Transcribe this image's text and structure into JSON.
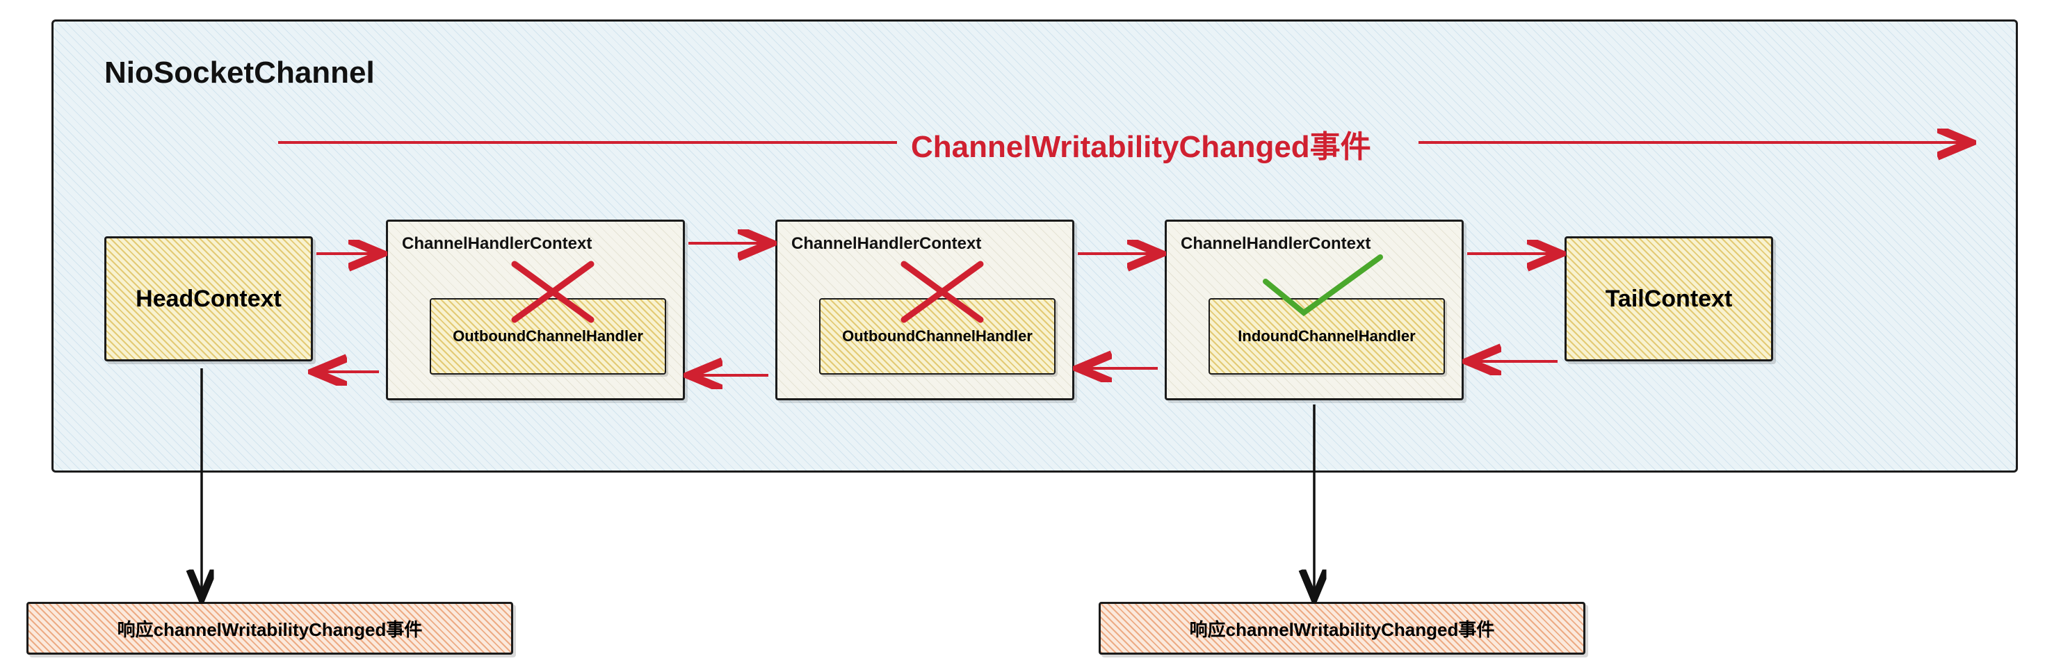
{
  "container_title": "NioSocketChannel",
  "event_label": "ChannelWritabilityChanged事件",
  "head_context": "HeadContext",
  "tail_context": "TailContext",
  "ctx_label": "ChannelHandlerContext",
  "outbound_handler": "OutboundChannelHandler",
  "inbound_handler": "IndoundChannelHandler",
  "response_box": "响应channelWritabilityChanged事件"
}
